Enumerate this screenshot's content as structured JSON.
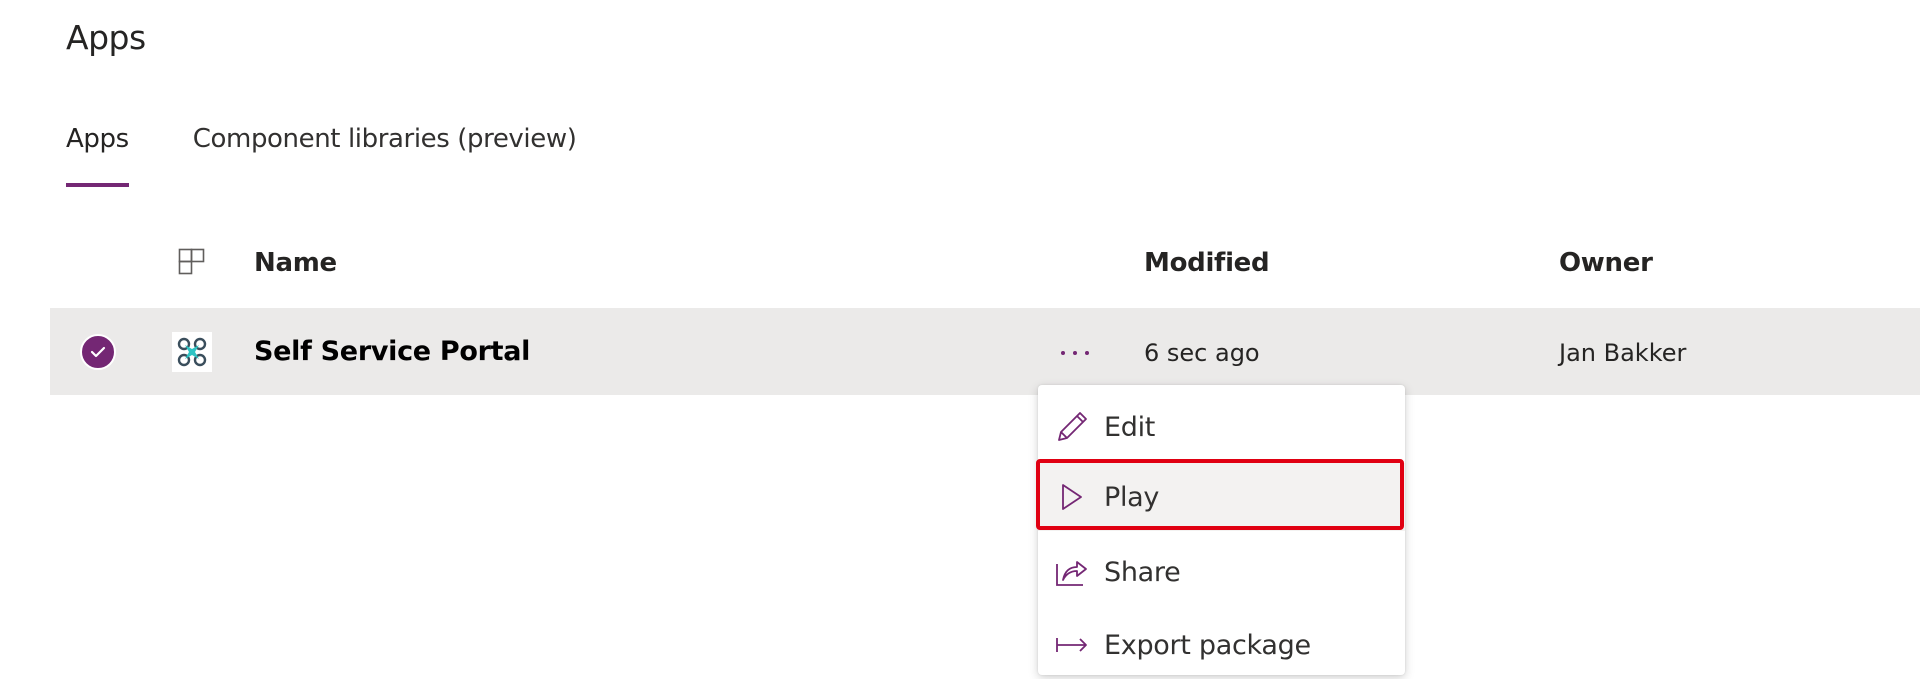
{
  "page": {
    "title": "Apps"
  },
  "tabs": [
    {
      "label": "Apps",
      "active": true
    },
    {
      "label": "Component libraries (preview)",
      "active": false
    }
  ],
  "table": {
    "columns": {
      "type_icon": "app-type-icon",
      "name": "Name",
      "modified": "Modified",
      "owner": "Owner"
    },
    "rows": [
      {
        "selected": true,
        "icon": "drone-app-icon",
        "name": "Self Service Portal",
        "modified": "6 sec ago",
        "owner": "Jan Bakker"
      }
    ]
  },
  "context_menu": {
    "items": [
      {
        "label": "Edit",
        "icon": "pencil-icon"
      },
      {
        "label": "Play",
        "icon": "play-icon",
        "highlighted": true
      },
      {
        "label": "Share",
        "icon": "share-icon"
      },
      {
        "label": "Export package",
        "icon": "export-arrow-icon"
      }
    ]
  },
  "colors": {
    "accent": "#742774",
    "selected_row": "#ebeae9",
    "highlight_border": "#e00012",
    "app_icon_teal": "#2ec4c4"
  }
}
